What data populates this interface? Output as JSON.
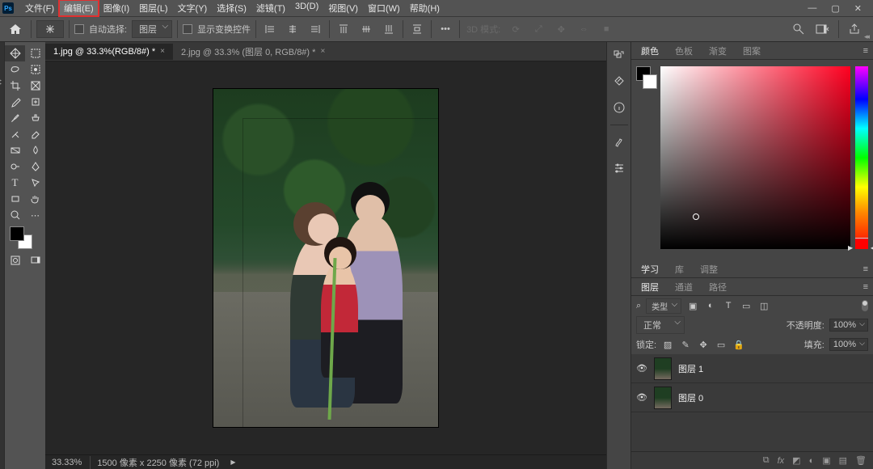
{
  "menu": {
    "items": [
      "文件(F)",
      "编辑(E)",
      "图像(I)",
      "图层(L)",
      "文字(Y)",
      "选择(S)",
      "滤镜(T)",
      "3D(D)",
      "视图(V)",
      "窗口(W)",
      "帮助(H)"
    ],
    "highlighted_index": 1
  },
  "window_controls": {
    "min": "—",
    "max": "▢",
    "close": "✕"
  },
  "options_bar": {
    "auto_select_label": "自动选择:",
    "auto_select_target": "图层",
    "show_transform_label": "显示变换控件",
    "mode3d_label": "3D 模式:"
  },
  "doc_tabs": [
    {
      "label": "1.jpg @ 33.3%(RGB/8#) *",
      "active": true
    },
    {
      "label": "2.jpg @ 33.3% (图层 0, RGB/8#) *",
      "active": false
    }
  ],
  "status": {
    "zoom": "33.33%",
    "dims": "1500 像素 x 2250 像素 (72 ppi)"
  },
  "panels": {
    "color": {
      "tabs": [
        "颜色",
        "色板",
        "渐变",
        "图案"
      ],
      "active": 0
    },
    "mid": {
      "tabs": [
        "学习",
        "库",
        "调整"
      ],
      "active": 0
    },
    "layers": {
      "tabs": [
        "图层",
        "通道",
        "路径"
      ],
      "active": 0,
      "filter_label": "类型",
      "blend_mode": "正常",
      "opacity_label": "不透明度:",
      "opacity_value": "100%",
      "lock_label": "锁定:",
      "fill_label": "填充:",
      "fill_value": "100%",
      "list": [
        {
          "name": "图层 1",
          "visible": true,
          "selected": false
        },
        {
          "name": "图层 0",
          "visible": true,
          "selected": false
        }
      ]
    }
  },
  "icons": {
    "search": "Q",
    "filter_kind": "类型"
  }
}
